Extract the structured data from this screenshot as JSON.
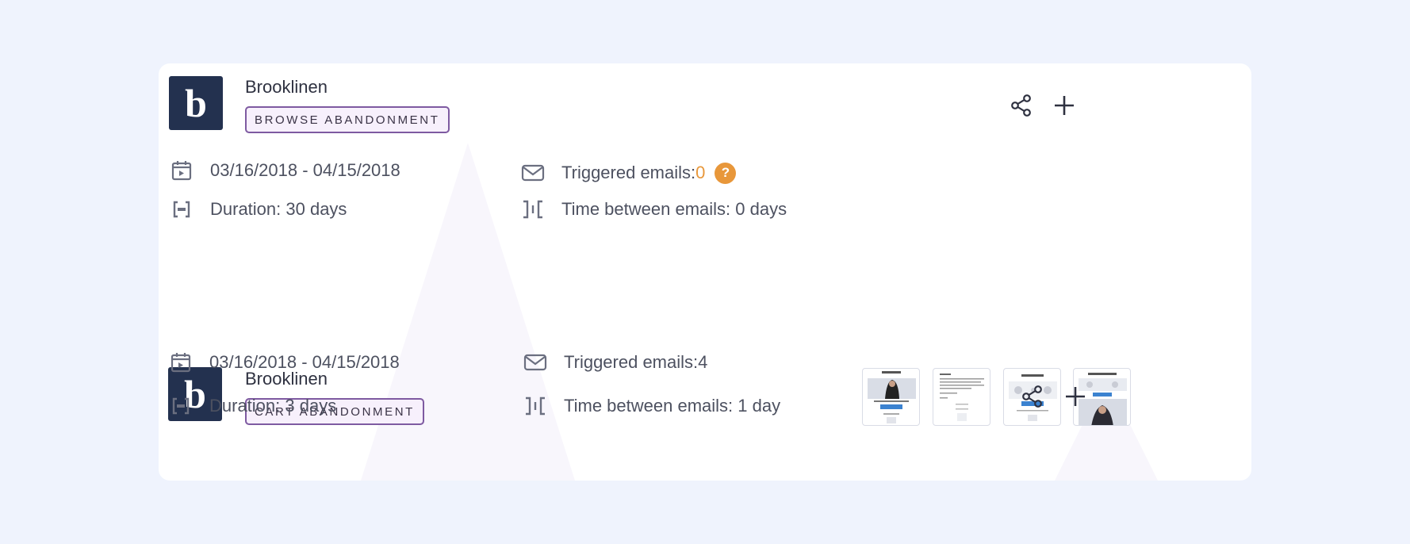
{
  "campaigns": [
    {
      "brand": "Brooklinen",
      "logo_letter": "b",
      "type": "BROWSE ABANDONMENT",
      "date_range": "03/16/2018 - 04/15/2018",
      "duration": "Duration: 30 days",
      "triggered_label": "Triggered emails: ",
      "triggered_count": "0",
      "help_glyph": "?",
      "time_between": "Time between emails: 0 days"
    },
    {
      "brand": "Brooklinen",
      "logo_letter": "b",
      "type": "CART ABANDONMENT",
      "date_range": "03/16/2018 - 04/15/2018",
      "duration": "Duration: 3 days",
      "triggered_label": "Triggered emails: ",
      "triggered_count": "4",
      "time_between": "Time between emails: 1 day",
      "email_thumbnails": [
        "email-thumbnail-1",
        "email-thumbnail-2",
        "email-thumbnail-3",
        "email-thumbnail-4"
      ]
    }
  ],
  "icons": [
    "calendar-icon",
    "duration-icon",
    "mail-icon",
    "interval-icon",
    "share-icon",
    "plus-icon",
    "help-icon"
  ],
  "colors": {
    "page_background": "#eff3fd",
    "logo_background": "#23314f",
    "badge_border": "#7e5aa1",
    "badge_background": "#f7f0fc",
    "accent_orange": "#e8973a"
  }
}
